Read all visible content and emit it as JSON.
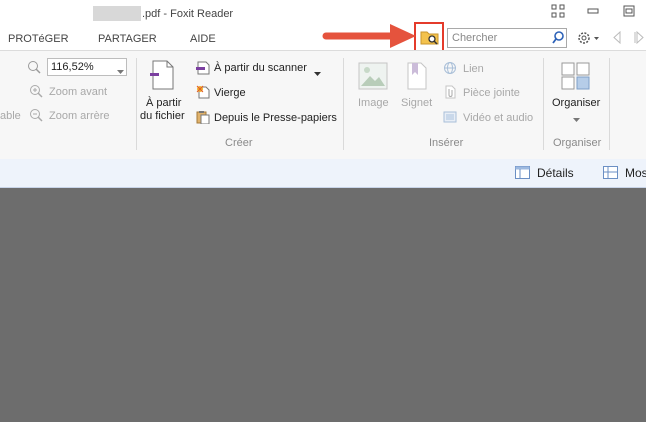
{
  "window": {
    "title_suffix": ".pdf - Foxit Reader"
  },
  "tabs": [
    "PROTéGER",
    "PARTAGER",
    "AIDE"
  ],
  "search": {
    "placeholder": "Chercher"
  },
  "ribbon": {
    "view": {
      "partial_label": "able",
      "zoom_value": "116,52%",
      "zoom_in": "Zoom avant",
      "zoom_out": "Zoom arrère"
    },
    "create": {
      "from_file_line1": "À partir",
      "from_file_line2": "du fichier",
      "from_scanner": "À partir du scanner",
      "blank": "Vierge",
      "from_clipboard": "Depuis le Presse-papiers",
      "group_label": "Créer"
    },
    "insert": {
      "image": "Image",
      "bookmark": "Signet",
      "link": "Lien",
      "attachment": "Pièce jointe",
      "video_audio": "Vidéo et audio",
      "group_label": "Insérer"
    },
    "organize": {
      "label": "Organiser",
      "group_label": "Organiser"
    }
  },
  "bluebar": {
    "details": "Détails",
    "more_partial": "Mos"
  },
  "colors": {
    "highlight": "#e43b2b",
    "arrow": "#e5533d",
    "bluebar": "#eef3fb",
    "document_bg": "#6d6d6d"
  },
  "icons": [
    "grid-icon",
    "minimize-icon",
    "restore-icon",
    "find-folder-icon",
    "search-icon",
    "gear-icon",
    "back-icon",
    "forward-icon"
  ]
}
